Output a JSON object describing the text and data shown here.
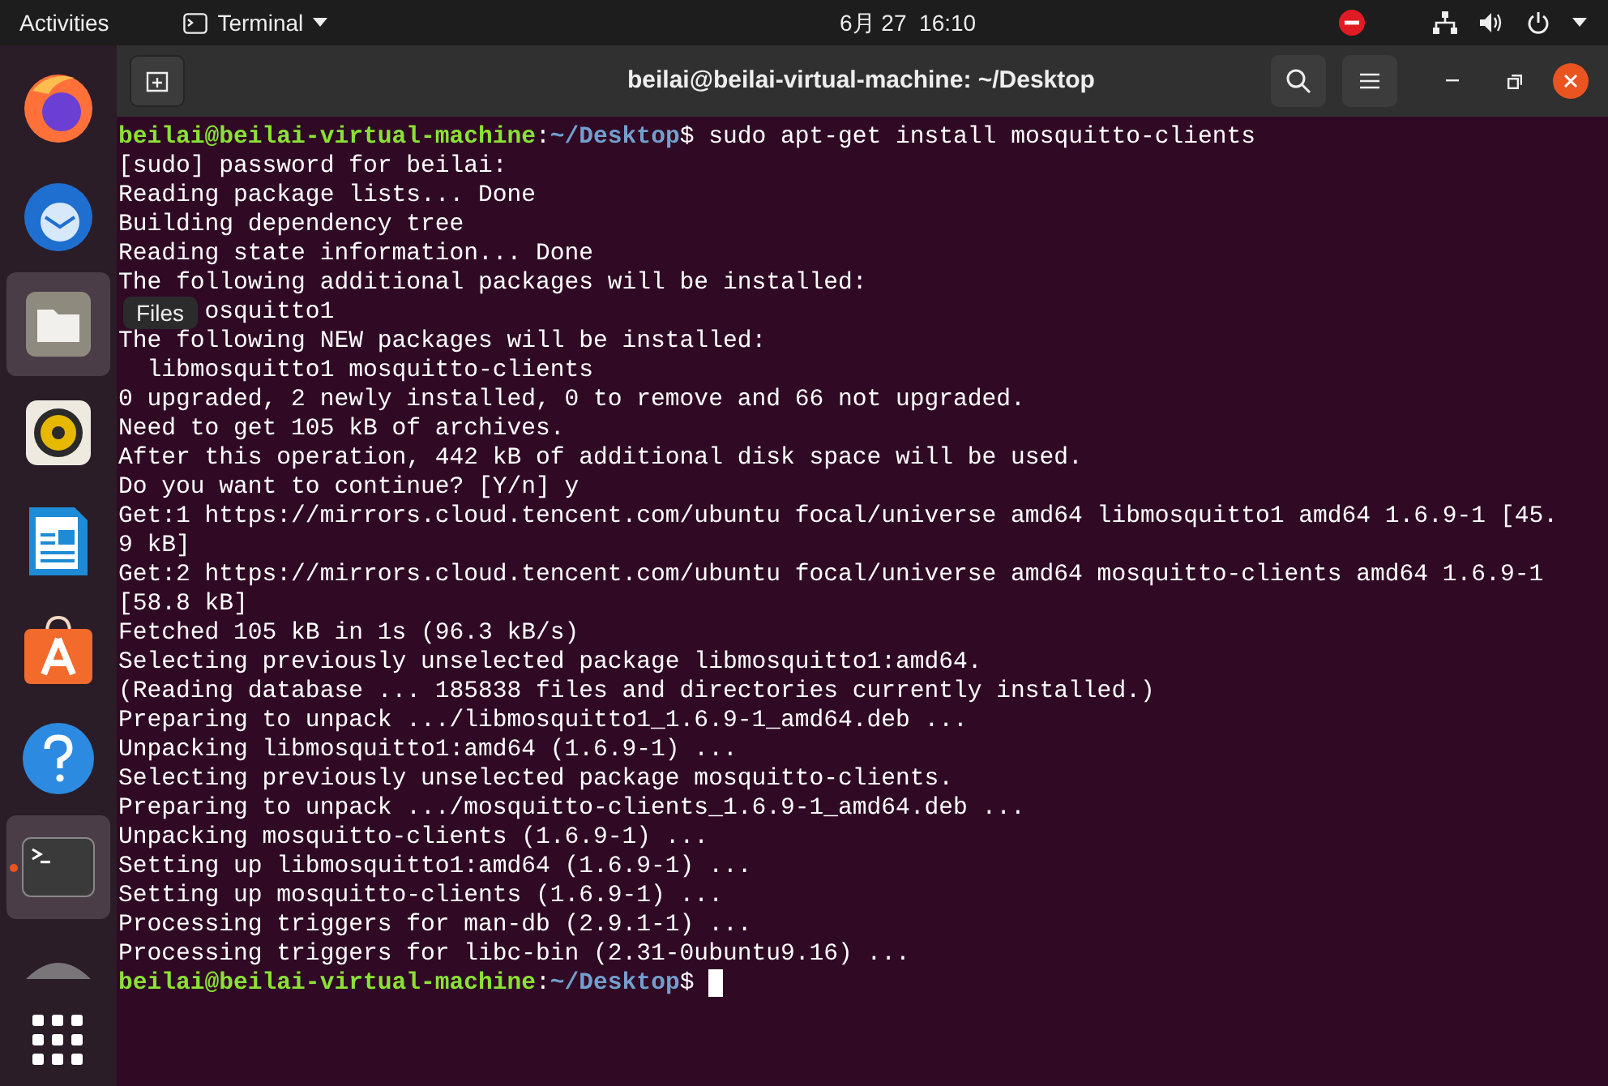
{
  "top_bar": {
    "activities": "Activities",
    "app_menu": "Terminal",
    "clock": "6月 27  16:10"
  },
  "dock": {
    "items": [
      {
        "kind": "firefox",
        "selected": false,
        "running": false
      },
      {
        "kind": "thunderbird",
        "selected": false,
        "running": false
      },
      {
        "kind": "files",
        "selected": true,
        "running": false
      },
      {
        "kind": "rhythmbox",
        "selected": false,
        "running": false
      },
      {
        "kind": "writer",
        "selected": false,
        "running": false
      },
      {
        "kind": "software",
        "selected": false,
        "running": false
      },
      {
        "kind": "help",
        "selected": false,
        "running": false
      },
      {
        "kind": "terminal",
        "selected": true,
        "running": true
      },
      {
        "kind": "disc",
        "selected": false,
        "running": false
      }
    ],
    "tooltip": "Files"
  },
  "window": {
    "title": "beilai@beilai-virtual-machine: ~/Desktop"
  },
  "terminal": {
    "lines": [
      {
        "kind": "prompt",
        "user": "beilai@beilai-virtual-machine",
        "separator": ":",
        "path": "~/Desktop",
        "symbol": "$",
        "command": "sudo apt-get install mosquitto-clients",
        "cursor": false
      },
      {
        "kind": "output",
        "text": "[sudo] password for beilai:"
      },
      {
        "kind": "output",
        "text": "Reading package lists... Done"
      },
      {
        "kind": "output",
        "text": "Building dependency tree"
      },
      {
        "kind": "output",
        "text": "Reading state information... Done"
      },
      {
        "kind": "output",
        "text": "The following additional packages will be installed:"
      },
      {
        "kind": "covered",
        "text": "osquitto1"
      },
      {
        "kind": "output",
        "text": "The following NEW packages will be installed:"
      },
      {
        "kind": "output",
        "text": "  libmosquitto1 mosquitto-clients"
      },
      {
        "kind": "output",
        "text": "0 upgraded, 2 newly installed, 0 to remove and 66 not upgraded."
      },
      {
        "kind": "output",
        "text": "Need to get 105 kB of archives."
      },
      {
        "kind": "output",
        "text": "After this operation, 442 kB of additional disk space will be used."
      },
      {
        "kind": "output",
        "text": "Do you want to continue? [Y/n] y"
      },
      {
        "kind": "output",
        "text": "Get:1 https://mirrors.cloud.tencent.com/ubuntu focal/universe amd64 libmosquitto1 amd64 1.6.9-1 [45."
      },
      {
        "kind": "output",
        "text": "9 kB]"
      },
      {
        "kind": "output",
        "text": "Get:2 https://mirrors.cloud.tencent.com/ubuntu focal/universe amd64 mosquitto-clients amd64 1.6.9-1"
      },
      {
        "kind": "output",
        "text": "[58.8 kB]"
      },
      {
        "kind": "output",
        "text": "Fetched 105 kB in 1s (96.3 kB/s)"
      },
      {
        "kind": "output",
        "text": "Selecting previously unselected package libmosquitto1:amd64."
      },
      {
        "kind": "output",
        "text": "(Reading database ... 185838 files and directories currently installed.)"
      },
      {
        "kind": "output",
        "text": "Preparing to unpack .../libmosquitto1_1.6.9-1_amd64.deb ..."
      },
      {
        "kind": "output",
        "text": "Unpacking libmosquitto1:amd64 (1.6.9-1) ..."
      },
      {
        "kind": "output",
        "text": "Selecting previously unselected package mosquitto-clients."
      },
      {
        "kind": "output",
        "text": "Preparing to unpack .../mosquitto-clients_1.6.9-1_amd64.deb ..."
      },
      {
        "kind": "output",
        "text": "Unpacking mosquitto-clients (1.6.9-1) ..."
      },
      {
        "kind": "output",
        "text": "Setting up libmosquitto1:amd64 (1.6.9-1) ..."
      },
      {
        "kind": "output",
        "text": "Setting up mosquitto-clients (1.6.9-1) ..."
      },
      {
        "kind": "output",
        "text": "Processing triggers for man-db (2.9.1-1) ..."
      },
      {
        "kind": "output",
        "text": "Processing triggers for libc-bin (2.31-0ubuntu9.16) ..."
      },
      {
        "kind": "prompt",
        "user": "beilai@beilai-virtual-machine",
        "separator": ":",
        "path": "~/Desktop",
        "symbol": "$",
        "cursor": true
      }
    ]
  }
}
